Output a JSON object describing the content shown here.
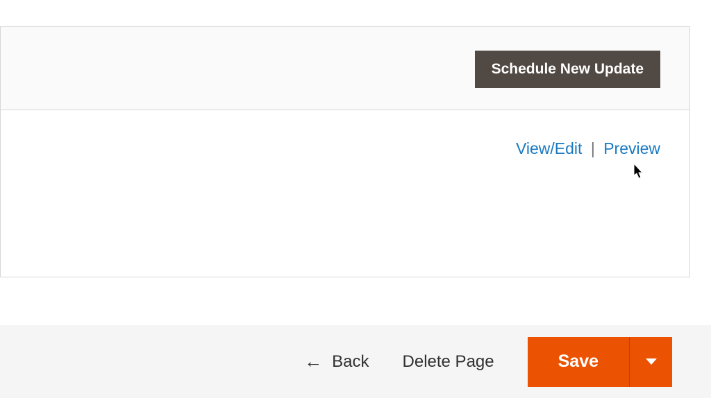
{
  "panel": {
    "schedule_button": "Schedule New Update",
    "links": {
      "view_edit": "View/Edit",
      "separator": "|",
      "preview": "Preview"
    }
  },
  "footer": {
    "back": "Back",
    "delete": "Delete Page",
    "save": "Save"
  },
  "colors": {
    "accent": "#eb5202",
    "dark_button": "#514943",
    "link": "#1979c3"
  }
}
